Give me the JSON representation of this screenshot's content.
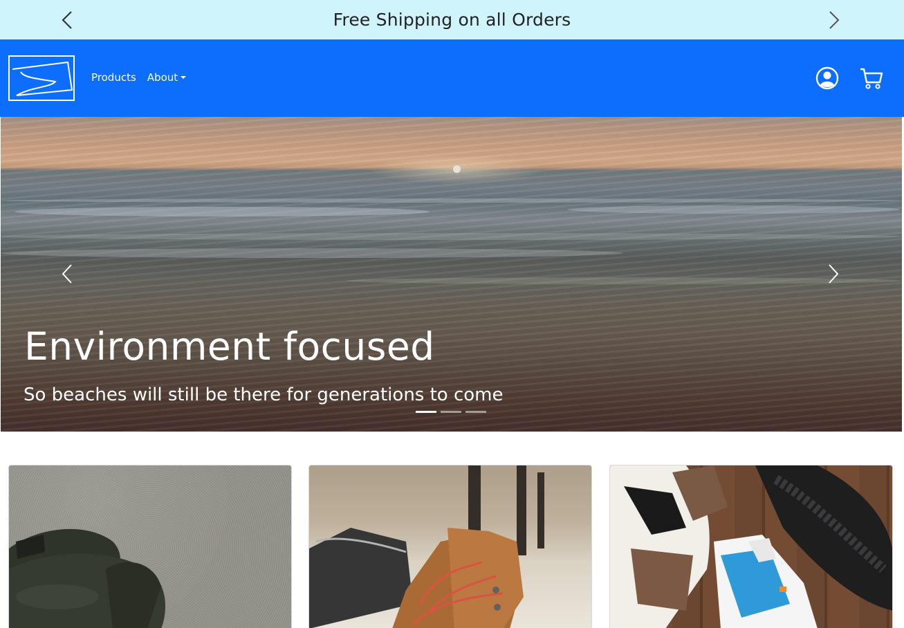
{
  "announcement": {
    "text": "Free Shipping on all Orders",
    "prev_icon": "chevron-left-icon",
    "next_icon": "chevron-right-icon"
  },
  "navbar": {
    "logo": "brand-logo",
    "links": [
      {
        "label": "Products"
      },
      {
        "label": "About",
        "dropdown": true
      }
    ],
    "icons": [
      "account-icon",
      "cart-icon"
    ],
    "background_color": "#0d6efd"
  },
  "hero": {
    "title": "Environment focused",
    "subtitle": "So beaches will still be there for generations to come",
    "slide_count": 3,
    "active_slide": 1
  },
  "products": [
    {
      "image": "sandals-on-sand"
    },
    {
      "image": "hiking-boots"
    },
    {
      "image": "sneakers-on-wood"
    }
  ],
  "colors": {
    "announce_bg": "#cff4fc",
    "navbar_bg": "#0d6efd",
    "text_light": "#ffffff"
  }
}
